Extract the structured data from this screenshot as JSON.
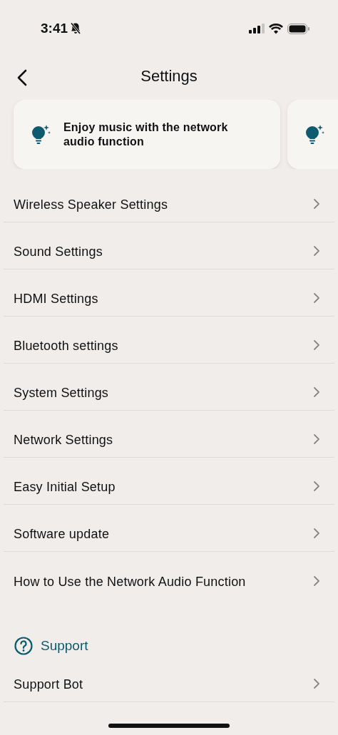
{
  "status_bar": {
    "time": "3:41",
    "silent": true
  },
  "header": {
    "title": "Settings"
  },
  "cards": [
    {
      "kind": "tip",
      "text": "Enjoy music with the network audio function"
    },
    {
      "kind": "tip"
    }
  ],
  "settings": [
    {
      "label": "Wireless Speaker Settings"
    },
    {
      "label": "Sound Settings"
    },
    {
      "label": "HDMI Settings"
    },
    {
      "label": "Bluetooth settings"
    },
    {
      "label": "System Settings"
    },
    {
      "label": "Network Settings"
    },
    {
      "label": "Easy Initial Setup"
    },
    {
      "label": "Software update"
    },
    {
      "label": "How to Use the Network Audio Function"
    }
  ],
  "support": {
    "title": "Support",
    "items": [
      {
        "label": "Support Bot"
      }
    ]
  }
}
